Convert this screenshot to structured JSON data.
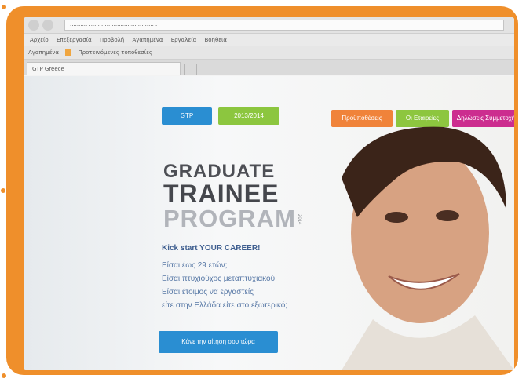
{
  "browser": {
    "address_url": "·········· ······.····· ························ ·",
    "menu_items": [
      "Αρχείο",
      "Επεξεργασία",
      "Προβολή",
      "Αγαπημένα",
      "Εργαλεία",
      "Βοήθεια"
    ],
    "favorites_label": "Αγαπημένα",
    "favorite_link": "Προτεινόμενες τοποθεσίες",
    "tab_title": "GTP Greece"
  },
  "header": {
    "logo_button": "GTP",
    "badge_button": "2013/2014",
    "nav": [
      "Προϋποθέσεις",
      "Οι Εταιρείες",
      "Δηλώσεις Συμμετοχής"
    ]
  },
  "hero": {
    "line1": "GRADUATE",
    "line2": "TRAINEE",
    "line3": "PROGRAM",
    "year": "2014",
    "tagline": "Kick start YOUR CAREER!",
    "bullets": [
      "Είσαι έως 29 ετών;",
      "Είσαι πτυχιούχος μεταπτυχιακού;",
      "Είσαι έτοιμος να εργαστείς",
      "είτε στην Ελλάδα είτε στο εξωτερικό;"
    ],
    "cta": "Κάνε την αίτηση σου τώρα"
  },
  "colors": {
    "frame": "#ef8f2b",
    "logo_blue": "#2a8ed2",
    "badge_green": "#8cc63f",
    "nav_orange": "#f0833a",
    "nav_green": "#8dc63f",
    "nav_magenta": "#cc2d8f",
    "headline_dark": "#4d4f55",
    "headline_light": "#b1b4ba",
    "copy_blue": "#5677a5"
  }
}
